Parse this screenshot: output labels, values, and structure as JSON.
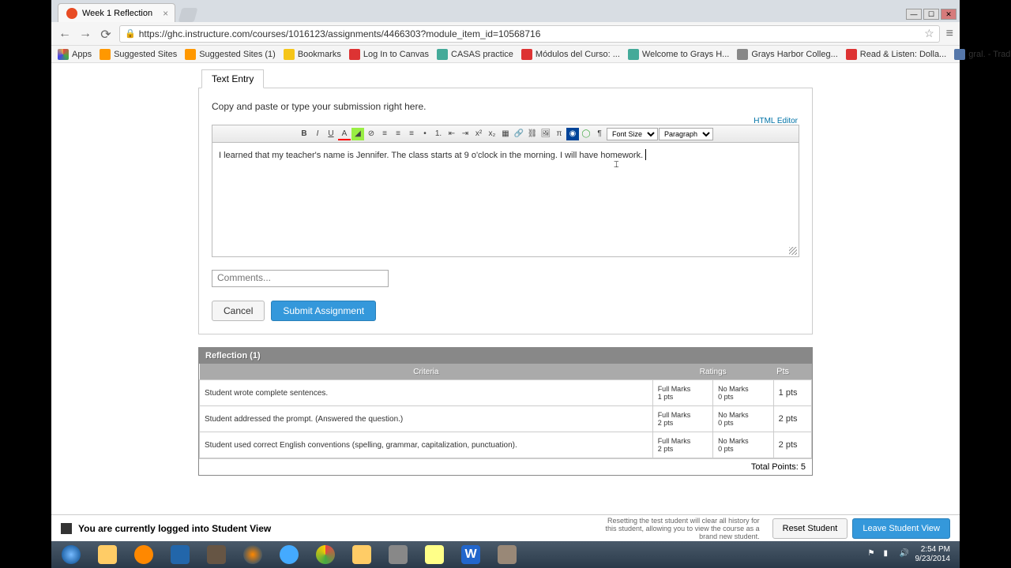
{
  "window": {
    "title": "Week 1 Reflection"
  },
  "url": "https://ghc.instructure.com/courses/1016123/assignments/4466303?module_item_id=10568716",
  "bookmarks": {
    "apps": "Apps",
    "items": [
      "Suggested Sites",
      "Suggested Sites (1)",
      "Bookmarks",
      "Log In to Canvas",
      "CASAS practice",
      "Módulos del Curso: ...",
      "Welcome to Grays H...",
      "Grays Harbor Colleg...",
      "Read & Listen: Dolla...",
      "gral. - Traducción al..."
    ]
  },
  "entry": {
    "tab": "Text Entry",
    "instruction": "Copy and paste or type your submission right here.",
    "html_editor": "HTML Editor",
    "content": "I learned that my teacher's name is Jennifer. The class starts at 9 o'clock in the morning. I will have homework.",
    "fontsize": "Font Size",
    "paragraph": "Paragraph",
    "comments_placeholder": "Comments...",
    "cancel": "Cancel",
    "submit": "Submit Assignment"
  },
  "rubric": {
    "title": "Reflection (1)",
    "headers": {
      "criteria": "Criteria",
      "ratings": "Ratings",
      "pts": "Pts"
    },
    "rows": [
      {
        "crit": "Student wrote complete sentences.",
        "full": "Full Marks",
        "fullpts": "1 pts",
        "no": "No Marks",
        "nopts": "0 pts",
        "pts": "1 pts"
      },
      {
        "crit": "Student addressed the prompt. (Answered the question.)",
        "full": "Full Marks",
        "fullpts": "2 pts",
        "no": "No Marks",
        "nopts": "0 pts",
        "pts": "2 pts"
      },
      {
        "crit": "Student used correct English conventions (spelling, grammar, capitalization, punctuation).",
        "full": "Full Marks",
        "fullpts": "2 pts",
        "no": "No Marks",
        "nopts": "0 pts",
        "pts": "2 pts"
      }
    ],
    "total": "Total Points: 5"
  },
  "studentview": {
    "msg": "You are currently logged into Student View",
    "note": "Resetting the test student will clear all history for this student, allowing you to view the course as a brand new student.",
    "reset": "Reset Student",
    "leave": "Leave Student View"
  },
  "tray": {
    "time": "2:54 PM",
    "date": "9/23/2014"
  }
}
